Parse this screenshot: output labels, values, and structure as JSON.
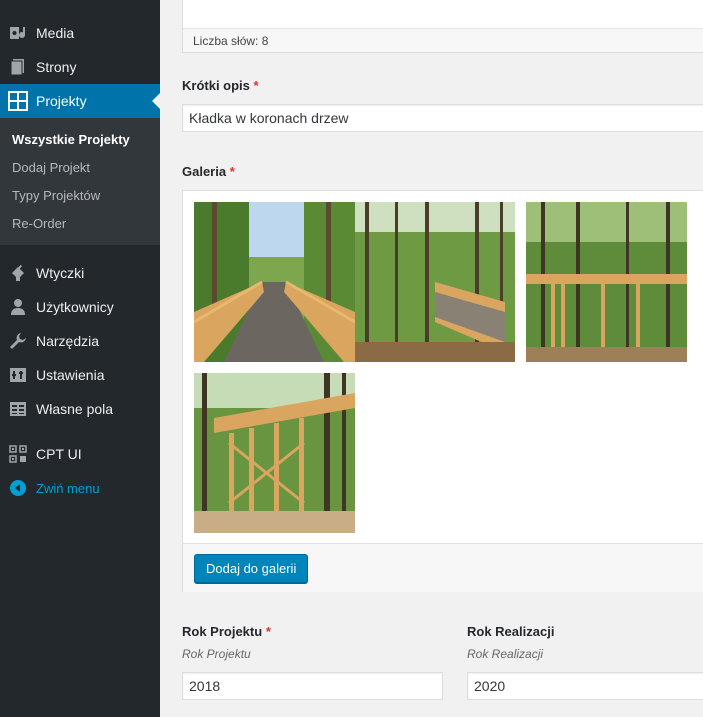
{
  "sidebar": {
    "items_top": [
      {
        "label": "Media",
        "icon": "media-icon"
      },
      {
        "label": "Strony",
        "icon": "pages-icon"
      },
      {
        "label": "Projekty",
        "icon": "grid-icon"
      }
    ],
    "submenu": [
      "Wszystkie Projekty",
      "Dodaj Projekt",
      "Typy Projektów",
      "Re-Order"
    ],
    "items_bottom": [
      {
        "label": "Wtyczki",
        "icon": "plugin-icon"
      },
      {
        "label": "Użytkownicy",
        "icon": "user-icon"
      },
      {
        "label": "Narzędzia",
        "icon": "wrench-icon"
      },
      {
        "label": "Ustawienia",
        "icon": "settings-icon"
      },
      {
        "label": "Własne pola",
        "icon": "table-icon"
      },
      {
        "label": "CPT UI",
        "icon": "cpt-icon"
      }
    ],
    "collapse_label": "Zwiń menu"
  },
  "editor": {
    "word_count": "Liczba słów: 8"
  },
  "short_desc": {
    "label": "Krótki opis",
    "required": "*",
    "value": "Kładka w koronach drzew"
  },
  "gallery": {
    "label": "Galeria",
    "required": "*",
    "add_button": "Dodaj do galerii",
    "images": [
      "treetop-walkway-photo-1",
      "treetop-walkway-photo-2",
      "treetop-walkway-photo-3",
      "treetop-walkway-photo-4"
    ]
  },
  "year_project": {
    "label": "Rok Projektu",
    "required": "*",
    "hint": "Rok Projektu",
    "value": "2018"
  },
  "year_realization": {
    "label": "Rok Realizacji",
    "hint": "Rok Realizacji",
    "value": "2020"
  },
  "colors": {
    "sidebar_bg": "#23282d",
    "submenu_bg": "#32373c",
    "active_bg": "#0073aa",
    "button_bg": "#0085ba",
    "required": "#dc3232"
  }
}
